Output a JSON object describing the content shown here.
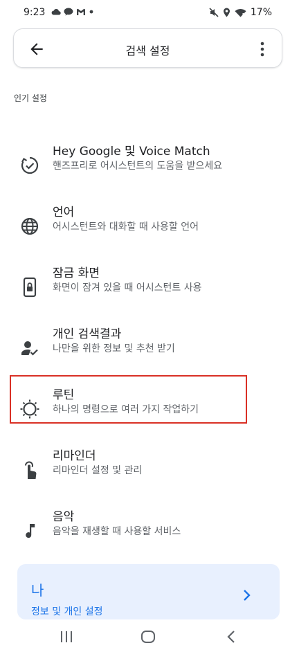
{
  "status_bar": {
    "time": "9:23",
    "battery": "17%",
    "icons": [
      "cloud-icon",
      "chat-icon",
      "gmail-icon",
      "dot-icon",
      "mute-icon",
      "location-icon",
      "wifi-icon",
      "battery-icon"
    ]
  },
  "header": {
    "title": "검색 설정",
    "back_icon": "arrow-left-icon",
    "more_icon": "more-vert-icon"
  },
  "section": {
    "label": "인기 설정"
  },
  "settings": [
    {
      "title": "Hey Google 및 Voice Match",
      "subtitle": "핸즈프리로 어시스턴트의 도움을 받으세요",
      "icon": "voice-match-icon"
    },
    {
      "title": "언어",
      "subtitle": "어시스턴트와 대화할 때 사용할 언어",
      "icon": "globe-icon"
    },
    {
      "title": "잠금 화면",
      "subtitle": "화면이 잠겨 있을 때 어시스턴트 사용",
      "icon": "lock-screen-icon"
    },
    {
      "title": "개인 검색결과",
      "subtitle": "나만을 위한 정보 및 추천 받기",
      "icon": "person-check-icon"
    },
    {
      "title": "루틴",
      "subtitle": "하나의 명령으로 여러 가지 작업하기",
      "icon": "routine-icon"
    },
    {
      "title": "리마인더",
      "subtitle": "리마인더 설정 및 관리",
      "icon": "reminder-icon"
    },
    {
      "title": "음악",
      "subtitle": "음악을 재생할 때 사용할 서비스",
      "icon": "music-note-icon"
    }
  ],
  "me_card": {
    "title": "나",
    "subtitle": "정보 및 개인 설정"
  },
  "colors": {
    "accent": "#1a73e8",
    "highlight": "#d93025",
    "card_bg": "#e8f0fe"
  }
}
